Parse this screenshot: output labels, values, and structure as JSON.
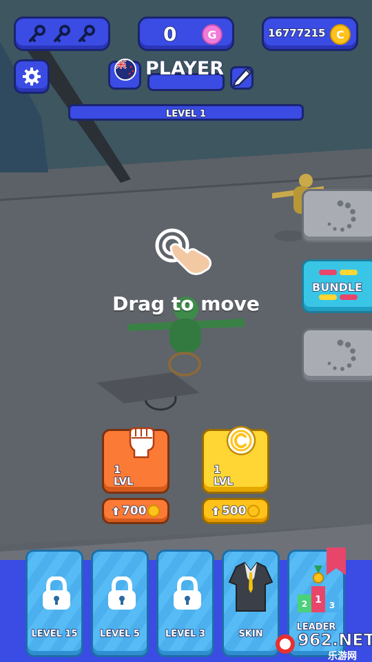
{
  "hud": {
    "keys_icon": "key-icon",
    "gems": "0",
    "gem_symbol": "G",
    "coins": "16777215",
    "coin_symbol": "C"
  },
  "player": {
    "name": "PLAYER",
    "flag": "new-zealand-flag"
  },
  "level": {
    "label": "LEVEL 1"
  },
  "hint": {
    "text": "Drag to move"
  },
  "side_buttons": {
    "bundle_label": "BUNDLE"
  },
  "upgrades": [
    {
      "id": "power",
      "lvl_number": "1",
      "lvl_word": "LVL",
      "price": "700",
      "icon": "fist-icon"
    },
    {
      "id": "income",
      "lvl_number": "1",
      "lvl_word": "LVL",
      "price": "500",
      "icon": "coin-icon"
    }
  ],
  "tabs": [
    {
      "label": "LEVEL 15",
      "icon": "lock-icon"
    },
    {
      "label": "LEVEL 5",
      "icon": "lock-icon"
    },
    {
      "label": "LEVEL 3",
      "icon": "lock-icon"
    },
    {
      "label": "SKIN",
      "icon": "suit-icon"
    },
    {
      "label": "LEADER",
      "icon": "podium-icon"
    }
  ],
  "watermark": {
    "text": "962.NET",
    "subtext": "乐游网"
  },
  "colors": {
    "hud_blue": "#3a4ce3",
    "orange_card": "#fb7a35",
    "yellow_card": "#ffd633",
    "tab_blue": "#4cb0ee",
    "bundle_cyan": "#39c6e6"
  }
}
